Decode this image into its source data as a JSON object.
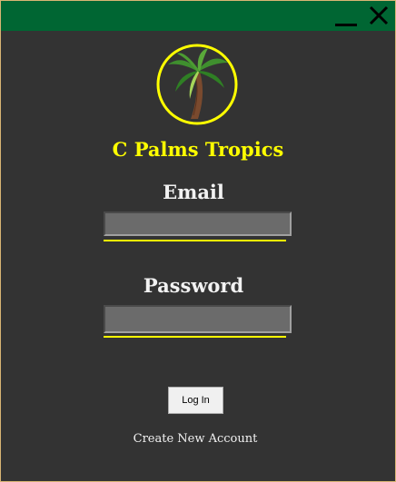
{
  "titlebar": {
    "minimize_icon": "minimize-icon",
    "close_icon": "close-icon",
    "color": "#006633"
  },
  "brand": {
    "name": "C Palms Tropics",
    "logo_icon": "palm-tree-icon",
    "color": "#ffff00"
  },
  "form": {
    "email_label": "Email",
    "email_value": "",
    "email_placeholder": "",
    "password_label": "Password",
    "password_value": "",
    "password_placeholder": "",
    "underline_color": "#ffff00"
  },
  "actions": {
    "login_label": "Log In",
    "create_account_label": "Create New Account"
  }
}
